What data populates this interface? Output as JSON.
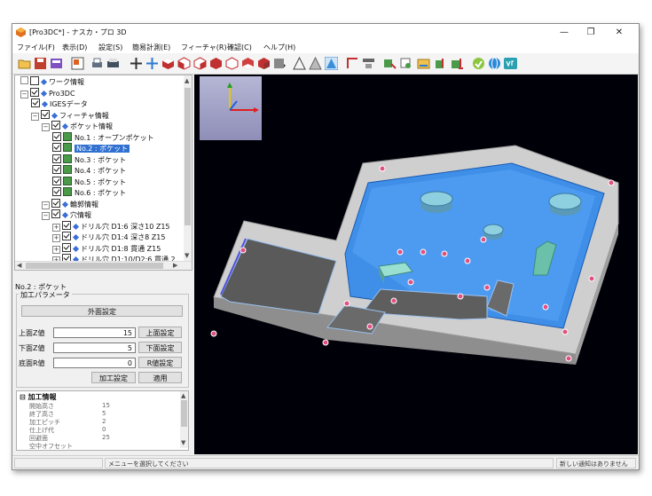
{
  "window": {
    "title": "[Pro3DC*] - ナスカ・プロ 3D",
    "controls": {
      "minimize": "—",
      "maximize": "❐",
      "close": "✕"
    }
  },
  "menu": [
    "ファイル(F)",
    "表示(D)",
    "設定(S)",
    "簡易計測(E)",
    "フィーチャ(R)",
    "確認(C)",
    "ヘルプ(H)"
  ],
  "toolbar_icons": [
    "open-folder-icon",
    "save-icon",
    "import-icon",
    "layout-icon",
    "print-preview-icon",
    "print-icon",
    "move-icon",
    "pan-icon",
    "view-top-icon",
    "view-front-icon",
    "view-side-icon",
    "view-iso-icon",
    "view-back-icon",
    "view-bottom-icon",
    "view-options-icon",
    "shading-wire-icon",
    "shading-flat-icon",
    "shading-smooth-icon",
    "measure-icon",
    "section-icon",
    "feature-recognize-icon",
    "feature-edit-icon",
    "toolpath-icon",
    "toolpath-check-icon",
    "simulate-icon",
    "check-icon",
    "globe-icon",
    "version-icon"
  ],
  "tree": {
    "items": [
      {
        "label": "ワーク情報",
        "depth": 0,
        "checked": false
      },
      {
        "label": "Pro3DC",
        "depth": 0,
        "checked": true
      },
      {
        "label": "IGESデータ",
        "depth": 1,
        "checked": true
      },
      {
        "label": "フィーチャ情報",
        "depth": 1,
        "checked": true
      },
      {
        "label": "ポケット情報",
        "depth": 2,
        "checked": true
      },
      {
        "label": "No.1 : オープンポケット",
        "depth": 3,
        "checked": true
      },
      {
        "label": "No.2 : ポケット",
        "depth": 3,
        "checked": true,
        "selected": true
      },
      {
        "label": "No.3 : ポケット",
        "depth": 3,
        "checked": true
      },
      {
        "label": "No.4 : ポケット",
        "depth": 3,
        "checked": true
      },
      {
        "label": "No.5 : ポケット",
        "depth": 3,
        "checked": true
      },
      {
        "label": "No.6 : ポケット",
        "depth": 3,
        "checked": true
      },
      {
        "label": "輪郭情報",
        "depth": 2,
        "checked": true
      },
      {
        "label": "穴情報",
        "depth": 2,
        "checked": true
      },
      {
        "label": "ドリル穴 D1:6 深さ10 Z15",
        "depth": 3,
        "checked": true
      },
      {
        "label": "ドリル穴 D1:4 深さ8 Z15",
        "depth": 3,
        "checked": true
      },
      {
        "label": "ドリル穴 D1:8 貫通 Z15",
        "depth": 3,
        "checked": true
      },
      {
        "label": "ドリル穴 D1:10/D2:6 貫通 2",
        "depth": 3,
        "checked": true
      }
    ]
  },
  "params": {
    "selection_label": "No.2 : ポケット",
    "group_title": "加工パラメータ",
    "outer_button": "外面設定",
    "top_z_label": "上面Z値",
    "top_z_value": "15",
    "top_z_button": "上面設定",
    "bottom_z_label": "下面Z値",
    "bottom_z_value": "5",
    "bottom_z_button": "下面設定",
    "base_r_label": "底面R値",
    "base_r_value": "0",
    "base_r_button": "R値設定",
    "machining_button": "加工設定",
    "apply_button": "適用"
  },
  "info": {
    "header": "加工情報",
    "rows": [
      {
        "label": "開始高さ",
        "value": "15"
      },
      {
        "label": "終了高さ",
        "value": "5"
      },
      {
        "label": "加工ピッチ",
        "value": "2"
      },
      {
        "label": "仕上げ代",
        "value": "0"
      },
      {
        "label": "回避面",
        "value": "25"
      },
      {
        "label": "空中オフセット",
        "value": ""
      }
    ]
  },
  "status": {
    "message": "メニューを選択してください",
    "notifications": "新しい通知はありません"
  },
  "colors": {
    "viewport_bg": "#000008",
    "pocket_blue": "#3f8fe8",
    "selection": "#3070d0"
  }
}
